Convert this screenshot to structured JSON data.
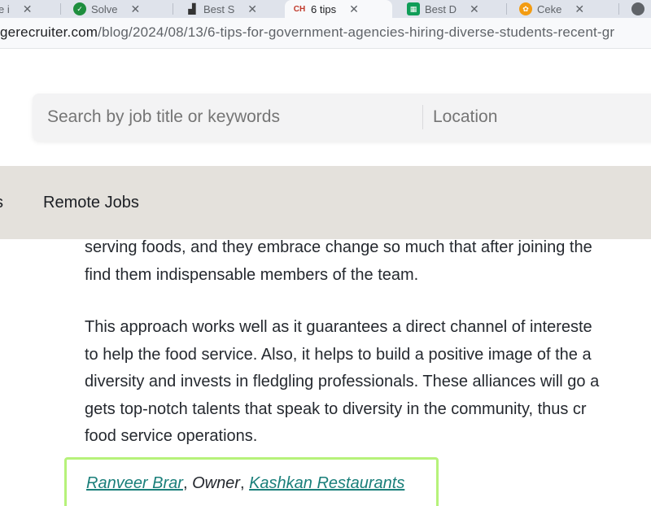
{
  "browser": {
    "tabs": [
      {
        "title": "e i",
        "icon": "generic-page-icon",
        "active": false
      },
      {
        "title": "Solve",
        "icon": "green-check-icon",
        "active": false
      },
      {
        "title": "Best S",
        "icon": "bar-chart-icon",
        "active": false
      },
      {
        "title": "6 tips",
        "icon": "ch-logo-icon",
        "active": true
      },
      {
        "title": "Best D",
        "icon": "sheets-icon",
        "active": false
      },
      {
        "title": "Ceke",
        "icon": "orange-flower-icon",
        "active": false
      }
    ],
    "url_host": "gerecruiter.com",
    "url_path": "/blog/2024/08/13/6-tips-for-government-agencies-hiring-diverse-students-recent-gr"
  },
  "search": {
    "keywords_placeholder": "Search by job title or keywords",
    "location_placeholder": "Location"
  },
  "nav": {
    "items": [
      "s",
      "Remote Jobs"
    ]
  },
  "article": {
    "paragraph1": [
      "serving foods, and they embrace change so much that after joining the",
      "find them indispensable members of the team."
    ],
    "paragraph2": [
      "This approach works well as it guarantees a direct channel of intereste",
      "to help the food service. Also, it helps to build a positive image of the a",
      "diversity and invests in fledgling professionals. These alliances will go a",
      "gets top-notch talents that speak to diversity in the community, thus cr",
      "food service operations."
    ]
  },
  "quote": {
    "name": "Ranveer Brar",
    "separator1": ", ",
    "role": "Owner",
    "separator2": ", ",
    "company": "Kashkan Restaurants"
  },
  "colors": {
    "nav_background": "#e4e1dc",
    "quote_border": "#b6f27a",
    "link": "#1a7f7a"
  }
}
